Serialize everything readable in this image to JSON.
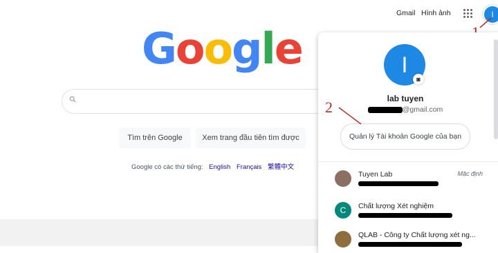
{
  "topbar": {
    "gmail": "Gmail",
    "images": "Hình ảnh",
    "avatar_letter": "I"
  },
  "annotations": {
    "one": "1",
    "two": "2"
  },
  "logo": {
    "letters": [
      {
        "ch": "G",
        "color": "#4285F4"
      },
      {
        "ch": "o",
        "color": "#EA4335"
      },
      {
        "ch": "o",
        "color": "#FBBC05"
      },
      {
        "ch": "g",
        "color": "#4285F4"
      },
      {
        "ch": "l",
        "color": "#34A853"
      },
      {
        "ch": "e",
        "color": "#EA4335"
      }
    ]
  },
  "buttons": {
    "search": "Tìm trên Google",
    "lucky": "Xem trang đầu tiên tìm được"
  },
  "languages": {
    "prefix": "Google có các thứ tiếng:",
    "items": [
      "English",
      "Français",
      "繁體中文"
    ]
  },
  "account_panel": {
    "avatar_letter": "I",
    "name": "lab tuyen",
    "email": "@gmail.com",
    "manage": "Quản lý Tài khoản Google của bạn",
    "accounts": [
      {
        "name": "Tuyen Lab",
        "default": "Mặc định",
        "avatar": "",
        "color": "#8d6e63"
      },
      {
        "name": "Chất lượng Xét nghiệm",
        "avatar": "C",
        "color": "#00897b"
      },
      {
        "name": "QLAB - Công ty Chất lượng xét ng...",
        "avatar": "",
        "color": "#8d6e3c"
      }
    ]
  }
}
